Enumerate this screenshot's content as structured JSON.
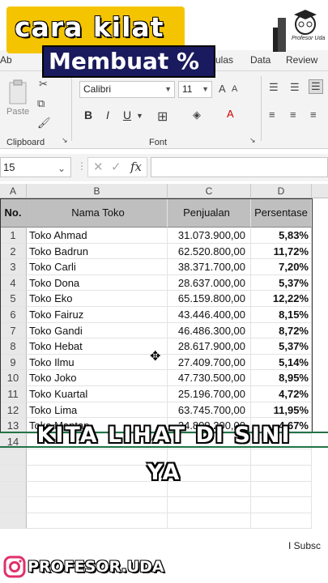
{
  "overlay": {
    "title_line1": "cara kilat",
    "title_line2": "Membuat %",
    "logo_text": "Profesor Uda",
    "subtitle_line1": "KITA LIHAT DI SINI",
    "subtitle_line2": "YA",
    "social_handle": "PROFESOR.UDA",
    "subscribe_label": "I  Subsc"
  },
  "menu": {
    "tabs": [
      "ulas",
      "Data",
      "Review"
    ]
  },
  "ribbon": {
    "paste_label": "Paste",
    "clipboard_label": "Clipboard",
    "font_label": "Font",
    "font_name": "Calibri",
    "font_size": "11",
    "bold": "B",
    "italic": "I",
    "underline": "U"
  },
  "formula_bar": {
    "name_box": "15",
    "fx": "fx"
  },
  "columns": [
    "A",
    "B",
    "C",
    "D"
  ],
  "table": {
    "headers": {
      "no": "No.",
      "name": "Nama Toko",
      "sales": "Penjualan",
      "pct": "Persentase"
    },
    "rows": [
      {
        "no": "1",
        "name": "Toko Ahmad",
        "sales": "31.073.900,00",
        "pct": "5,83%"
      },
      {
        "no": "2",
        "name": "Toko Badrun",
        "sales": "62.520.800,00",
        "pct": "11,72%"
      },
      {
        "no": "3",
        "name": "Toko Carli",
        "sales": "38.371.700,00",
        "pct": "7,20%"
      },
      {
        "no": "4",
        "name": "Toko Dona",
        "sales": "28.637.000,00",
        "pct": "5,37%"
      },
      {
        "no": "5",
        "name": "Toko Eko",
        "sales": "65.159.800,00",
        "pct": "12,22%"
      },
      {
        "no": "6",
        "name": "Toko Fairuz",
        "sales": "43.446.400,00",
        "pct": "8,15%"
      },
      {
        "no": "7",
        "name": "Toko Gandi",
        "sales": "46.486.300,00",
        "pct": "8,72%"
      },
      {
        "no": "8",
        "name": "Toko Hebat",
        "sales": "28.617.900,00",
        "pct": "5,37%"
      },
      {
        "no": "9",
        "name": "Toko Ilmu",
        "sales": "27.409.700,00",
        "pct": "5,14%"
      },
      {
        "no": "10",
        "name": "Toko Joko",
        "sales": "47.730.500,00",
        "pct": "8,95%"
      },
      {
        "no": "11",
        "name": "Toko Kuartal",
        "sales": "25.196.700,00",
        "pct": "4,72%"
      },
      {
        "no": "12",
        "name": "Toko Lima",
        "sales": "63.745.700,00",
        "pct": "11,95%"
      },
      {
        "no": "13",
        "name": "Toko Mantap",
        "sales": "24.809.200,00",
        "pct": "4,67%"
      }
    ],
    "row_numbers": [
      "1",
      "2",
      "3",
      "4",
      "5",
      "6",
      "7",
      "8",
      "9",
      "10",
      "11",
      "12",
      "13",
      "14"
    ]
  }
}
